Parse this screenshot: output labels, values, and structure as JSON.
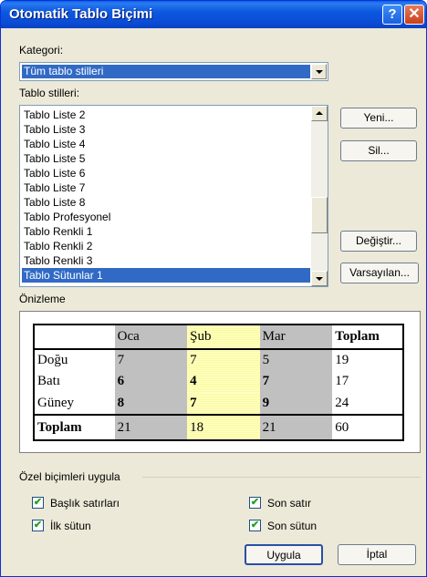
{
  "window": {
    "title": "Otomatik Tablo Biçimi",
    "help_glyph": "?",
    "close_glyph": "✕"
  },
  "category": {
    "label": "Kategori:",
    "selected": "Tüm tablo stilleri"
  },
  "styles": {
    "label": "Tablo stilleri:",
    "items": [
      "Tablo Liste 2",
      "Tablo Liste 3",
      "Tablo Liste 4",
      "Tablo Liste 5",
      "Tablo Liste 6",
      "Tablo Liste 7",
      "Tablo Liste 8",
      "Tablo Profesyonel",
      "Tablo Renkli 1",
      "Tablo Renkli 2",
      "Tablo Renkli 3",
      "Tablo Sütunlar 1"
    ],
    "selected_index": 11
  },
  "buttons": {
    "new": "Yeni...",
    "delete": "Sil...",
    "modify": "Değiştir...",
    "default": "Varsayılan...",
    "apply": "Uygula",
    "cancel": "İptal"
  },
  "preview": {
    "label": "Önizleme",
    "headers": [
      "",
      "Oca",
      "Şub",
      "Mar",
      "Toplam"
    ],
    "rows": [
      [
        "Doğu",
        "7",
        "7",
        "5",
        "19"
      ],
      [
        "Batı",
        "6",
        "4",
        "7",
        "17"
      ],
      [
        "Güney",
        "8",
        "7",
        "9",
        "24"
      ]
    ],
    "total": [
      "Toplam",
      "21",
      "18",
      "21",
      "60"
    ]
  },
  "special_formats": {
    "label": "Özel biçimleri uygula",
    "options": [
      {
        "label": "Başlık satırları",
        "checked": true
      },
      {
        "label": "Son satır",
        "checked": true
      },
      {
        "label": "İlk sütun",
        "checked": true
      },
      {
        "label": "Son sütun",
        "checked": true
      }
    ],
    "check_glyph": "✔"
  },
  "colors": {
    "title_bar": "#0b4cd6",
    "selection": "#316ac5",
    "dialog_bg": "#ece9d8",
    "preview_gray": "#c0c0c0",
    "preview_yellow": "#ffffcc"
  }
}
